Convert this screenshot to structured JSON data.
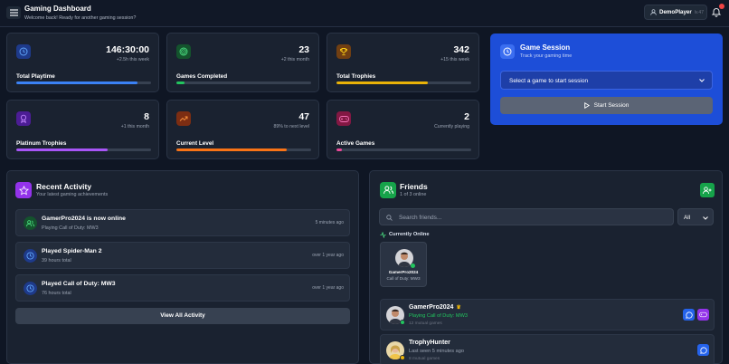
{
  "header": {
    "title": "Gaming Dashboard",
    "subtitle": "Welcome back! Ready for another gaming session?",
    "username": "DemoPlayer",
    "level": "lv.47",
    "notification_count": "1"
  },
  "stats": [
    {
      "id": "total-playtime",
      "icon": "clock-icon",
      "value": "146:30:00",
      "change": "+2.5h this week",
      "label": "Total Playtime",
      "progress": 0.9,
      "color": "#3b82f6"
    },
    {
      "id": "games-completed",
      "icon": "target-icon",
      "value": "23",
      "change": "+2 this month",
      "label": "Games Completed",
      "progress": 0.06,
      "color": "#22c55e"
    },
    {
      "id": "total-trophies",
      "icon": "trophy-icon",
      "value": "342",
      "change": "+15 this week",
      "label": "Total Trophies",
      "progress": 0.68,
      "color": "#eab308"
    },
    {
      "id": "platinum-trophies",
      "icon": "award-icon",
      "value": "8",
      "change": "+1 this month",
      "label": "Platinum Trophies",
      "progress": 0.68,
      "color": "#a855f7"
    },
    {
      "id": "current-level",
      "icon": "trending-up-icon",
      "value": "47",
      "change": "89% to next level",
      "label": "Current Level",
      "progress": 0.82,
      "color": "#f97316"
    },
    {
      "id": "active-games",
      "icon": "gamepad-icon",
      "value": "2",
      "change": "Currently playing",
      "label": "Active Games",
      "progress": 0.04,
      "color": "#ec4899"
    }
  ],
  "game_session": {
    "title": "Game Session",
    "subtitle": "Track your gaming time",
    "select_placeholder": "Select a game to start session",
    "start_label": "Start Session"
  },
  "activity": {
    "title": "Recent Activity",
    "subtitle": "Your latest gaming achievements",
    "items": [
      {
        "title": "GamerPro2024 is now online",
        "sub": "Playing Call of Duty: MW3",
        "time": "5 minutes ago",
        "icon": "users-icon",
        "color": "#22c55e"
      },
      {
        "title": "Played Spider-Man 2",
        "sub": "39 hours total",
        "time": "over 1 year ago",
        "icon": "clock-icon",
        "color": "#3b82f6"
      },
      {
        "title": "Played Call of Duty: MW3",
        "sub": "76 hours total",
        "time": "over 1 year ago",
        "icon": "clock-icon",
        "color": "#3b82f6"
      }
    ],
    "view_all": "View All Activity"
  },
  "friends": {
    "title": "Friends",
    "subtitle": "1 of 3 online",
    "search_placeholder": "Search friends...",
    "filter": "All",
    "online_label": "Currently Online",
    "online_tile": {
      "name": "GamerPro2024",
      "game": "Call of Duty: MW3"
    },
    "list": [
      {
        "name": "GamerPro2024",
        "status": "Playing Call of Duty: MW3",
        "mutual": "12 mutual games",
        "status_color": "#22c55e",
        "dot": "#22c55e"
      },
      {
        "name": "TrophyHunter",
        "status": "Last seen 5 minutes ago",
        "mutual": "8 mutual games",
        "status_color": "#9aa3b2",
        "dot": "#eab308"
      }
    ]
  }
}
